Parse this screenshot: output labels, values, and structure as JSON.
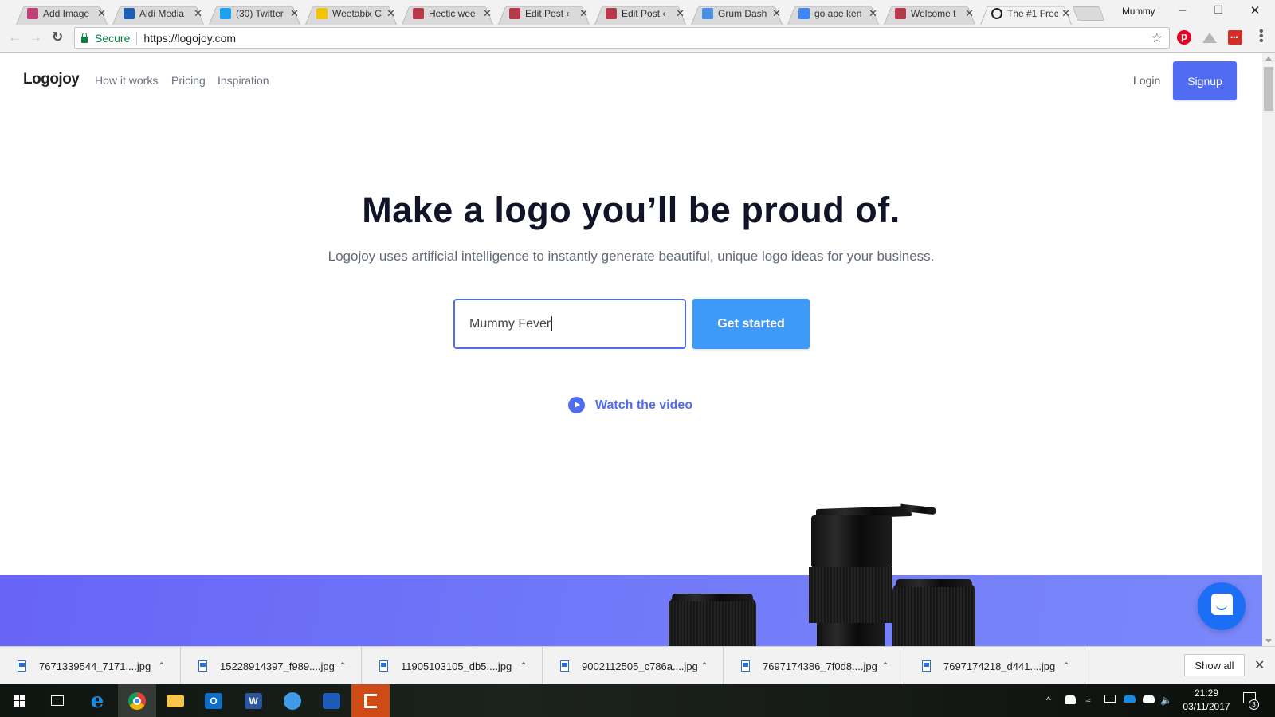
{
  "browser": {
    "tabs": [
      {
        "title": "Add Image",
        "favicon": "feather-icon",
        "color": "#c2407a"
      },
      {
        "title": "Aldi Media",
        "favicon": "aldi-icon",
        "color": "#1f5fb3"
      },
      {
        "title": "(30) Twitter",
        "favicon": "twitter-icon",
        "color": "#1da1f2"
      },
      {
        "title": "Weetabix C",
        "favicon": "weetabix-icon",
        "color": "#f2c500"
      },
      {
        "title": "Hectic wee",
        "favicon": "blog-icon",
        "color": "#b83a4a"
      },
      {
        "title": "Edit Post ‹",
        "favicon": "blog-icon",
        "color": "#b83a4a"
      },
      {
        "title": "Edit Post ‹",
        "favicon": "blog-icon",
        "color": "#b83a4a"
      },
      {
        "title": "Grum Dash",
        "favicon": "grum-icon",
        "color": "#4a90e2"
      },
      {
        "title": "go ape ken",
        "favicon": "google-icon",
        "color": "#4285f4"
      },
      {
        "title": "Welcome t",
        "favicon": "blog-icon",
        "color": "#b83a4a"
      },
      {
        "title": "The #1 Free",
        "favicon": "logojoy-icon",
        "color": "#222222",
        "active": true
      }
    ],
    "profile_name": "Mummy",
    "window_controls": {
      "minimize": "–",
      "restore": "❐",
      "close": "✕"
    },
    "address": {
      "secure_label": "Secure",
      "url": "https://logojoy.com"
    },
    "extensions": [
      "pinterest-icon",
      "drive-icon",
      "lastpass-icon"
    ]
  },
  "site": {
    "logo": "Logojoy",
    "nav": [
      "How it works",
      "Pricing",
      "Inspiration"
    ],
    "login_label": "Login",
    "signup_label": "Signup",
    "hero": {
      "title": "Make a logo you’ll be proud of.",
      "subtitle": "Logojoy uses artificial intelligence to instantly generate beautiful, unique logo ideas for your business.",
      "input_value": "Mummy Fever",
      "cta_label": "Get started",
      "video_label": "Watch the video"
    },
    "colors": {
      "accent": "#506cf0",
      "cta": "#3d9af9",
      "band_start": "#6764f6",
      "band_end": "#7a88fb",
      "chat": "#1b6ef5"
    }
  },
  "downloads": {
    "items": [
      "7671339544_7171....jpg",
      "15228914397_f989....jpg",
      "11905103105_db5....jpg",
      "9002112505_c786a....jpg",
      "7697174386_7f0d8....jpg",
      "7697174218_d441....jpg"
    ],
    "show_all_label": "Show all",
    "close_label": "✕"
  },
  "taskbar": {
    "apps": [
      "windows-start-icon",
      "task-view-icon",
      "edge-icon",
      "chrome-icon",
      "file-explorer-icon",
      "outlook-icon",
      "word-icon",
      "messaging-icon",
      "security-icon",
      "office-icon"
    ],
    "clock_time": "21:29",
    "clock_date": "03/11/2017",
    "notification_count": "3"
  }
}
